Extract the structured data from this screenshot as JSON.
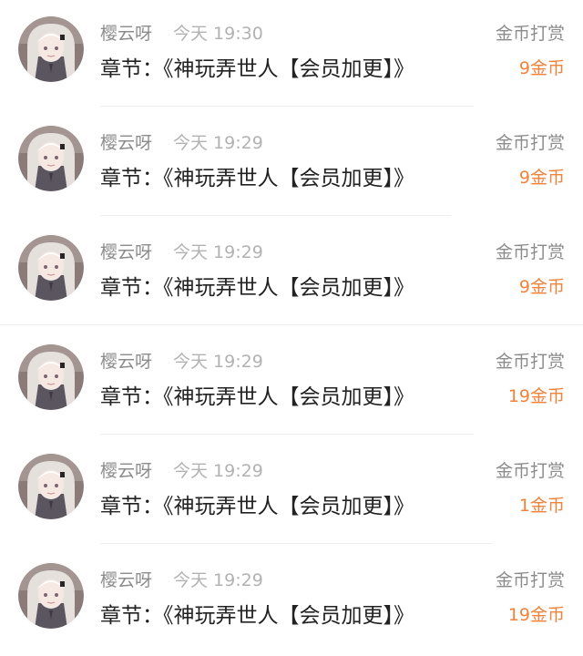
{
  "colors": {
    "name": "#8c8c8c",
    "time": "#b2b2b2",
    "chapter": "#222222",
    "type": "#8c8c8c",
    "amount": "#f0823c",
    "divider": "#eeeeee"
  },
  "records": [
    {
      "user": "樱云呀",
      "time": "今天 19:30",
      "chapter": "章节：《神玩弄世人【会员加更】》",
      "type": "金币打赏",
      "amount": "9金币",
      "avatar": "user-avatar"
    },
    {
      "user": "樱云呀",
      "time": "今天 19:29",
      "chapter": "章节：《神玩弄世人【会员加更】》",
      "type": "金币打赏",
      "amount": "9金币",
      "avatar": "user-avatar"
    },
    {
      "user": "樱云呀",
      "time": "今天 19:29",
      "chapter": "章节：《神玩弄世人【会员加更】》",
      "type": "金币打赏",
      "amount": "9金币",
      "avatar": "user-avatar"
    },
    {
      "user": "樱云呀",
      "time": "今天 19:29",
      "chapter": "章节：《神玩弄世人【会员加更】》",
      "type": "金币打赏",
      "amount": "19金币",
      "avatar": "user-avatar"
    },
    {
      "user": "樱云呀",
      "time": "今天 19:29",
      "chapter": "章节：《神玩弄世人【会员加更】》",
      "type": "金币打赏",
      "amount": "1金币",
      "avatar": "user-avatar"
    },
    {
      "user": "樱云呀",
      "time": "今天 19:29",
      "chapter": "章节：《神玩弄世人【会员加更】》",
      "type": "金币打赏",
      "amount": "19金币",
      "avatar": "user-avatar"
    }
  ]
}
